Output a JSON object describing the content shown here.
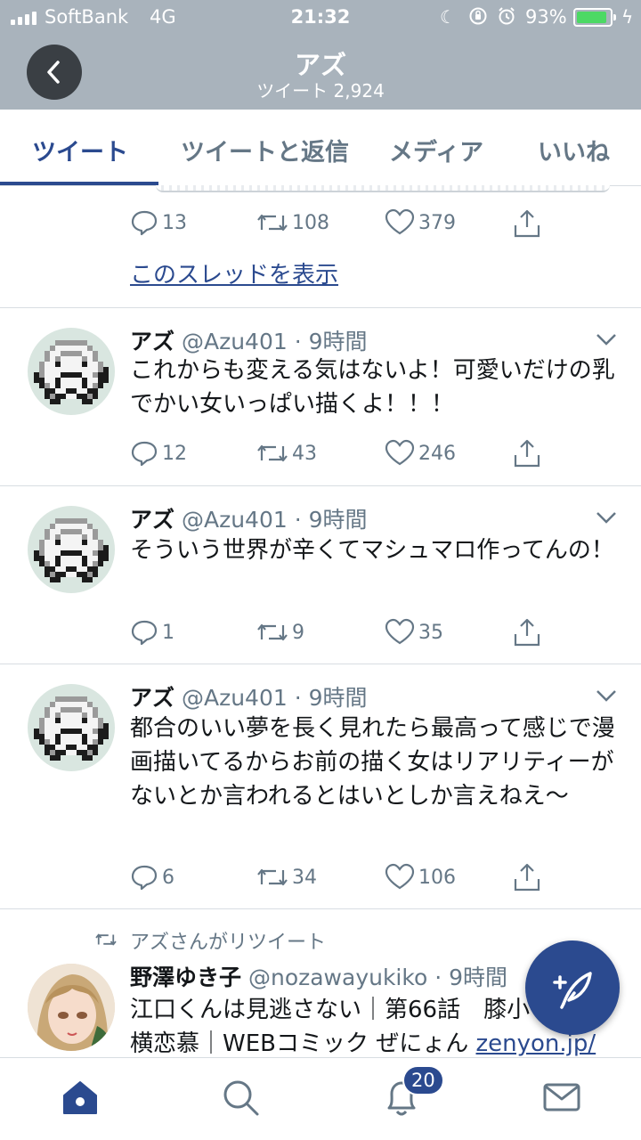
{
  "status_bar": {
    "carrier": "SoftBank",
    "network": "4G",
    "time": "21:32",
    "battery": "93%",
    "battery_level": 0.93
  },
  "header": {
    "title": "アズ",
    "subtitle": "ツイート 2,924"
  },
  "tabs": [
    {
      "label": "ツイート",
      "active": true
    },
    {
      "label": "ツイートと返信",
      "active": false
    },
    {
      "label": "メディア",
      "active": false
    },
    {
      "label": "いいね",
      "active": false
    }
  ],
  "first_tweet_actions": {
    "replies": "13",
    "retweets": "108",
    "likes": "379"
  },
  "thread_link": "このスレッドを表示",
  "tweets": [
    {
      "name": "アズ",
      "handle": "@Azu401",
      "time": "· 9時間",
      "text": "これからも変える気はないよ！可愛いだけの乳でかい女いっぱい描くよ！！！",
      "replies": "12",
      "retweets": "43",
      "likes": "246"
    },
    {
      "name": "アズ",
      "handle": "@Azu401",
      "time": "· 9時間",
      "text": "そういう世界が辛くてマシュマロ作ってんの！",
      "replies": "1",
      "retweets": "9",
      "likes": "35"
    },
    {
      "name": "アズ",
      "handle": "@Azu401",
      "time": "· 9時間",
      "text": "都合のいい夢を長く見れたら最高って感じで漫画描いてるからお前の描く女はリアリティーがないとか言われるとはいとしか言えねえ〜",
      "replies": "6",
      "retweets": "34",
      "likes": "106"
    }
  ],
  "retweet": {
    "label": "アズさんがリツイート",
    "name": "野澤ゆき子",
    "handle": "@nozawayukiko",
    "time": "· 9時間",
    "text_line1": "江口くんは見逃さない｜第66話　膝小",
    "text_line2": "横恋慕｜WEBコミック ぜにょん ",
    "link": "zenyon.jp/"
  },
  "bottom_nav": {
    "notifications_badge": "20"
  },
  "colors": {
    "header_bg": "#a9b3bc",
    "accent": "#2b4a8f",
    "muted": "#657786",
    "battery": "#4cd964"
  }
}
